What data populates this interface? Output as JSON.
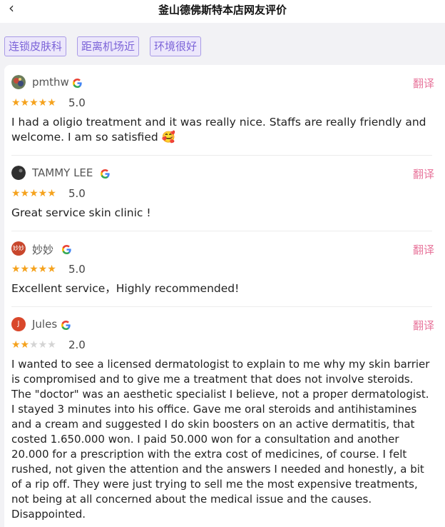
{
  "header": {
    "title": "釜山德佛斯特本店网友评价",
    "back_icon": "chevron-left-icon"
  },
  "tags": [
    "连锁皮肤科",
    "距离机场近",
    "环境很好"
  ],
  "translate_label": "翻译",
  "colors": {
    "tag_border": "#a99be6",
    "tag_text": "#7b63d8",
    "translate": "#e8769c",
    "star": "#f5a21d"
  },
  "reviews": [
    {
      "user": "pmthw",
      "rating": 5,
      "rating_text": "5.0",
      "text": "I had a oligio treatment and it was really nice. Staffs are really friendly and welcome. I am so satisfied 🥰"
    },
    {
      "user": "TAMMY LEE",
      "rating": 5,
      "rating_text": "5.0",
      "text": "Great service skin clinic !"
    },
    {
      "user": "妙妙",
      "avatar_text": "妙妙",
      "rating": 5,
      "rating_text": "5.0",
      "text": "Excellent service，Highly recommended!"
    },
    {
      "user": "Jules",
      "avatar_text": "J",
      "rating": 2,
      "rating_text": "2.0",
      "text": "I wanted to see a licensed dermatologist to explain to me why my skin barrier is compromised and to give me a treatment that does not involve steroids. The \"doctor\" was an aesthetic specialist I believe, not a proper dermatologist. I stayed 3 minutes into his office. Gave me oral steroids and antihistamines and a cream and suggested I do skin boosters on an active dermatitis, that costed 1.650.000 won. I paid 50.000 won for a consultation and another 20.000 for a prescription with the extra cost of medicines, of course. I felt rushed, not given the attention and the answers I needed and honestly, a bit of a rip off. They were just trying to sell me the most expensive treatments, not being at all concerned about the medical issue and the causes. Disappointed."
    }
  ]
}
